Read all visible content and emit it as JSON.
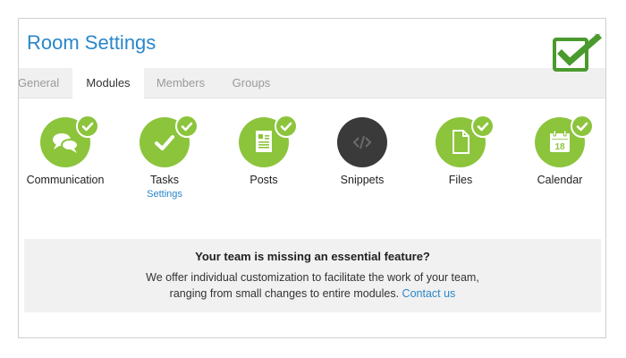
{
  "dialog": {
    "title": "Room Settings",
    "close_glyph": "×"
  },
  "tabs": [
    {
      "label": "General",
      "active": false
    },
    {
      "label": "Modules",
      "active": true
    },
    {
      "label": "Members",
      "active": false
    },
    {
      "label": "Groups",
      "active": false
    }
  ],
  "modules": [
    {
      "label": "Communication",
      "icon": "chat-bubbles-icon",
      "enabled": true,
      "link": ""
    },
    {
      "label": "Tasks",
      "icon": "checkmark-icon",
      "enabled": true,
      "link": "Settings"
    },
    {
      "label": "Posts",
      "icon": "document-icon",
      "enabled": true,
      "link": ""
    },
    {
      "label": "Snippets",
      "icon": "code-icon",
      "enabled": false,
      "link": ""
    },
    {
      "label": "Files",
      "icon": "file-icon",
      "enabled": true,
      "link": ""
    },
    {
      "label": "Calendar",
      "icon": "calendar-icon",
      "enabled": true,
      "link": "",
      "calendar_day": "18"
    }
  ],
  "banner": {
    "title": "Your team is missing an essential feature?",
    "line1": "We offer individual customization to facilitate the work of your team,",
    "line2": "ranging from small changes to entire modules.",
    "link": "Contact us"
  },
  "colors": {
    "accent_blue": "#2a86c9",
    "module_green": "#8cc43c",
    "module_disabled": "#3a3a3a",
    "overlay_check_green": "#4a9a2e"
  }
}
